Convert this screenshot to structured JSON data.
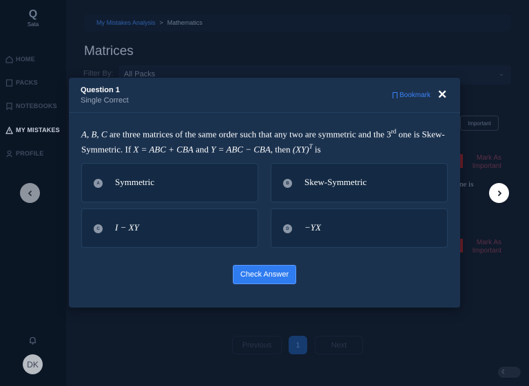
{
  "app": {
    "logo_text": "Sata"
  },
  "sidebar": {
    "items": [
      {
        "label": "HOME",
        "icon": "home-icon"
      },
      {
        "label": "PACKS",
        "icon": "packs-icon"
      },
      {
        "label": "NOTEBOOKS",
        "icon": "bookmark-icon"
      },
      {
        "label": "MY MISTAKES",
        "icon": "warning-icon",
        "active": true
      },
      {
        "label": "PROFILE",
        "icon": "user-icon"
      }
    ],
    "avatar_initials": "DK"
  },
  "breadcrumb": {
    "link": "My Mistakes Analysis",
    "separator": ">",
    "current": "Mathematics"
  },
  "page": {
    "title": "Matrices",
    "filter_label": "Filter By:",
    "filter_value": "All Packs",
    "important_chip": "Important",
    "mark_important_1": "Mark As Important",
    "mark_important_2": "Mark As Important",
    "fragment_text": "ne is"
  },
  "pagination": {
    "previous": "Previous",
    "current_page": "1",
    "next": "Next"
  },
  "modal": {
    "title": "Question 1",
    "type": "Single Correct",
    "bookmark_label": "Bookmark",
    "question": {
      "p1": "A, B, C",
      "p2": " are three matrices of the same order such that any two are symmetric and the ",
      "p3": "3",
      "p4": "rd",
      "p5": " one is Skew-Symmetric. If ",
      "p6": "X = ABC + CBA",
      "p7": " and ",
      "p8": "Y = ABC − CBA",
      "p9": ", then ",
      "p10": "(XY)",
      "p11": "T",
      "p12": " is"
    },
    "options": [
      {
        "letter": "A",
        "text": "Symmetric"
      },
      {
        "letter": "B",
        "text": "Skew-Symmetric"
      },
      {
        "letter": "C",
        "text": "I − XY"
      },
      {
        "letter": "D",
        "text": "−YX"
      }
    ],
    "check_button": "Check Answer"
  }
}
